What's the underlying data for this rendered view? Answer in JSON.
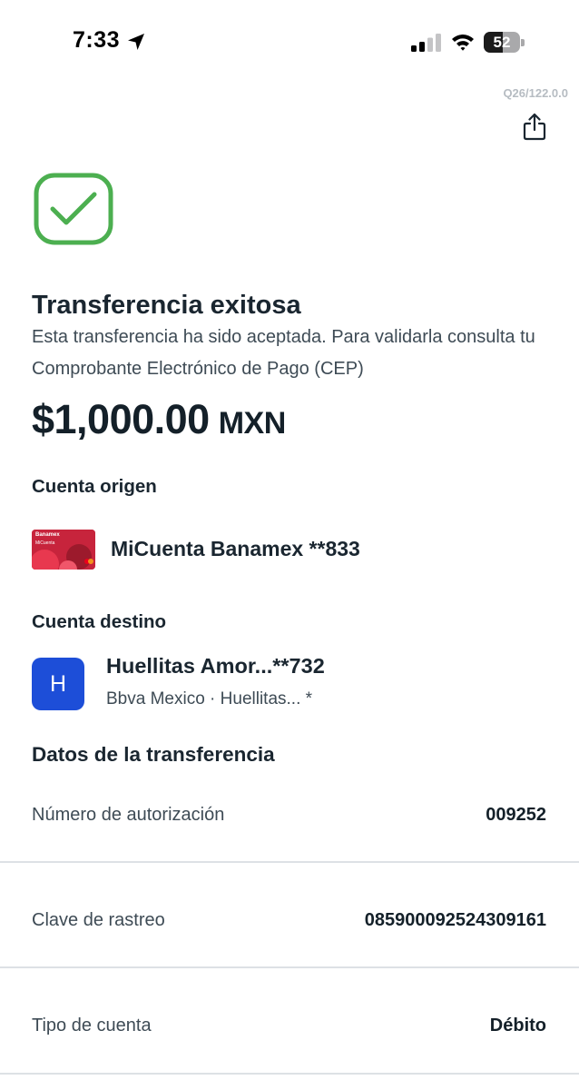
{
  "status_bar": {
    "time": "7:33",
    "battery": "52",
    "battery_level": 0.52
  },
  "header": {
    "version": "Q26/122.0.0"
  },
  "result": {
    "title": "Transferencia exitosa",
    "description": "Esta transferencia ha sido aceptada. Para validarla consulta tu Comprobante Electrónico de Pago (CEP)",
    "amount": "$1,000.00",
    "currency": "MXN"
  },
  "origin": {
    "label": "Cuenta origen",
    "account_name": "MiCuenta Banamex **833",
    "card_brand": "Banamex",
    "card_product": "MiCuenta"
  },
  "destination": {
    "label": "Cuenta destino",
    "avatar_letter": "H",
    "name": "Huellitas Amor...**732",
    "detail": "Bbva Mexico · Huellitas... *"
  },
  "transfer_data": {
    "title": "Datos de la transferencia",
    "rows": [
      {
        "label": "Número de autorización",
        "value": "009252"
      },
      {
        "label": "Clave de rastreo",
        "value": "085900092524309161"
      },
      {
        "label": "Tipo de cuenta",
        "value": "Débito"
      }
    ]
  },
  "colors": {
    "success": "#4caf50",
    "avatar": "#1d4ed8",
    "card": "#c7243c"
  },
  "icons": [
    "location-arrow-icon",
    "cellular-signal-icon",
    "wifi-icon",
    "battery-icon",
    "share-icon",
    "success-check-icon"
  ]
}
